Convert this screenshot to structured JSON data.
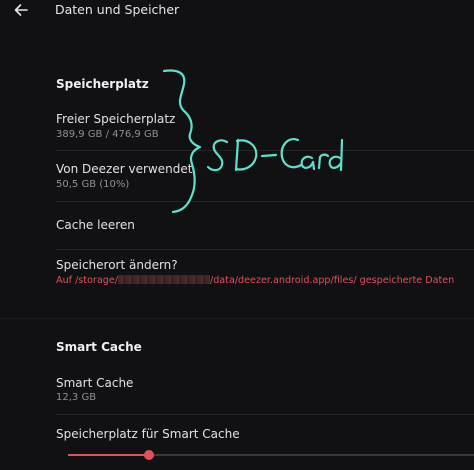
{
  "header": {
    "title": "Daten und Speicher",
    "back_icon": "arrow-left-icon"
  },
  "storage": {
    "section_title": "Speicherplatz",
    "free_space": {
      "label": "Freier Speicherplatz",
      "value": "389,9 GB / 476,9 GB"
    },
    "deezer_used": {
      "label": "Von Deezer verwendet",
      "value": "50,5 GB (10%)"
    },
    "clear_cache": {
      "label": "Cache leeren"
    },
    "change_location": {
      "label": "Speicherort ändern?",
      "path_prefix": "Auf /storage/",
      "path_suffix": "/data/deezer.android.app/files/ gespeicherte Daten"
    }
  },
  "smart_cache": {
    "section_title": "Smart Cache",
    "smart_cache_row": {
      "label": "Smart Cache",
      "value": "12,3 GB"
    },
    "space_row": {
      "label": "Speicherplatz für Smart Cache",
      "slider_fraction": 0.2
    }
  },
  "annotation": {
    "handwritten_text": "SD-Card",
    "color": "#5ee0cc"
  },
  "colors": {
    "accent": "#e2505c",
    "background": "#111113"
  }
}
